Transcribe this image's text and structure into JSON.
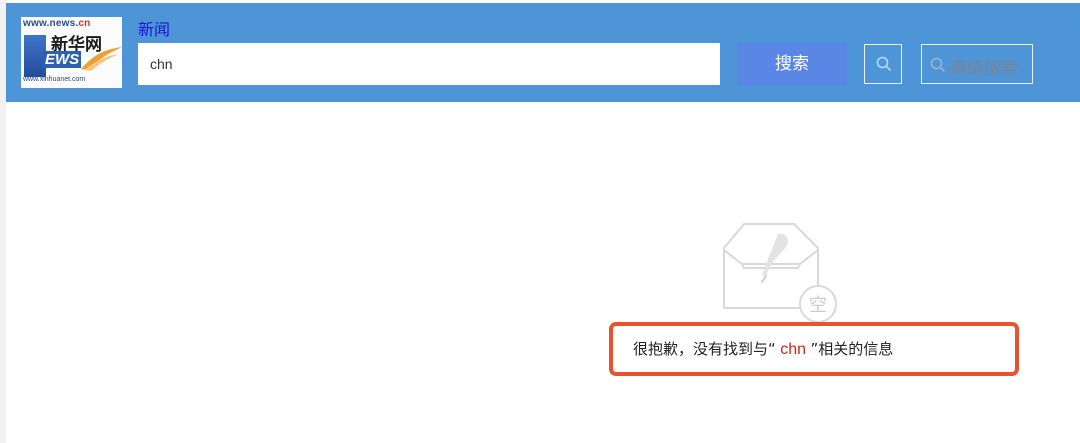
{
  "logo": {
    "domain_top_prefix": "www.news.",
    "domain_top_suffix": "cn",
    "name_cn": "新华网",
    "letters": "EWS",
    "domain_bottom": "www.xinhuanet.com"
  },
  "header": {
    "tab_label": "新闻"
  },
  "search": {
    "query": "chn",
    "button_label": "搜索",
    "icon": "search-icon",
    "advanced_label": "高级搜索"
  },
  "empty_state": {
    "icon": "empty-inbox-icon",
    "icon_char": "空",
    "message_prefix": "很抱歉，没有找到与“",
    "keyword": " chn ",
    "message_suffix": "”相关的信息"
  },
  "colors": {
    "header_bg": "#4e95d7",
    "search_button": "#5a87e6",
    "tab_link": "#1a14d6",
    "keyword": "#c8281e",
    "highlight_border": "#e8522e"
  }
}
